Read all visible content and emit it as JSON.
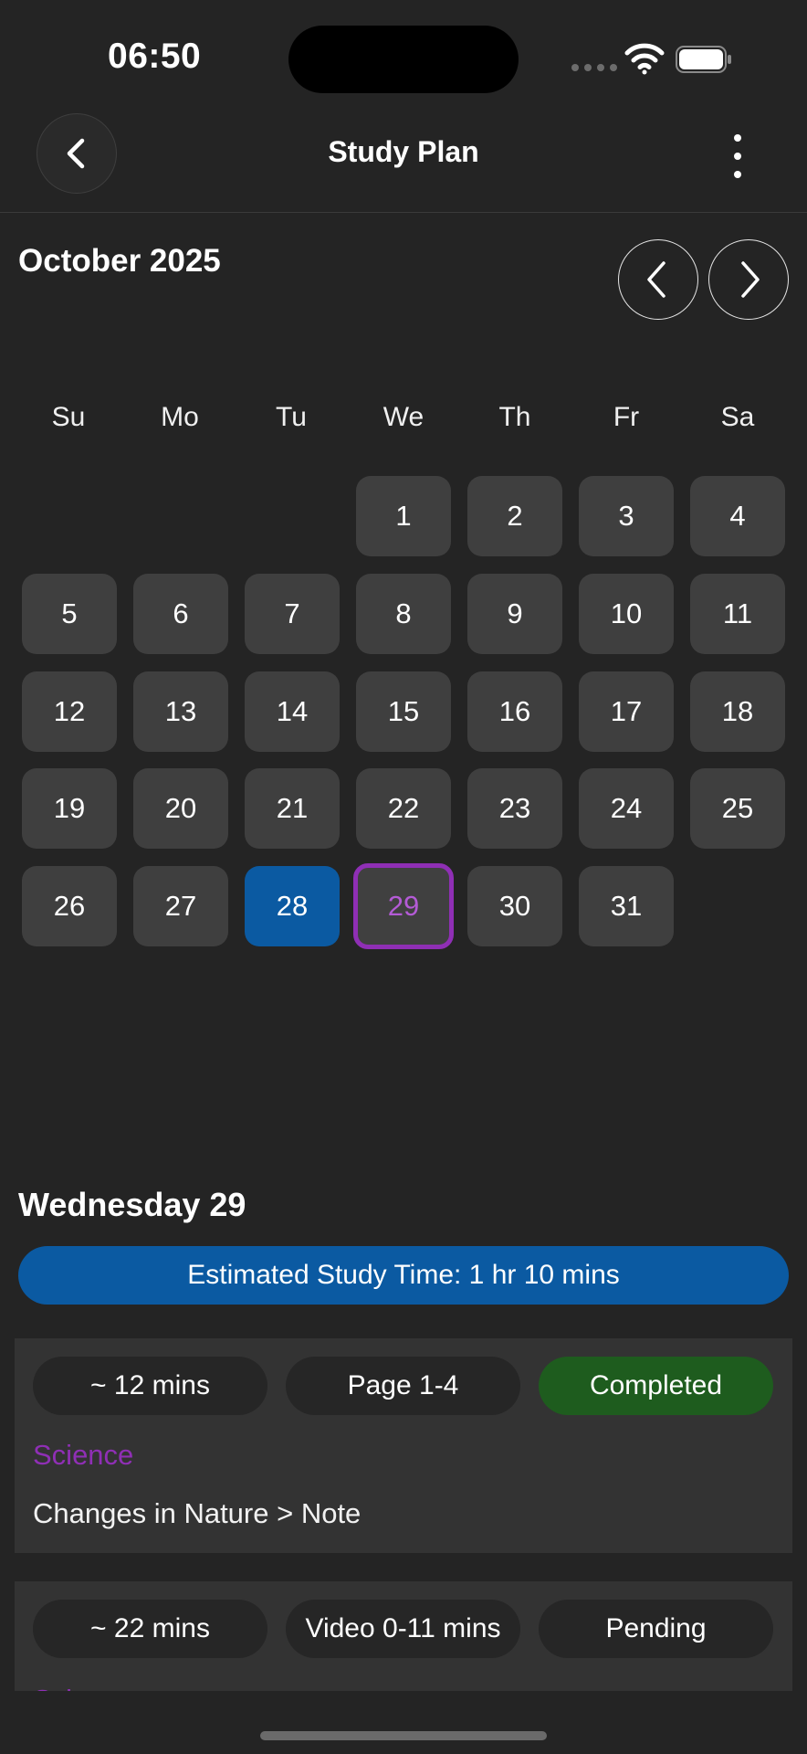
{
  "status_bar": {
    "time": "06:50"
  },
  "nav": {
    "title": "Study Plan"
  },
  "calendar": {
    "month_label": "October 2025",
    "weekdays": [
      "Su",
      "Mo",
      "Tu",
      "We",
      "Th",
      "Fr",
      "Sa"
    ],
    "days": [
      "1",
      "2",
      "3",
      "4",
      "5",
      "6",
      "7",
      "8",
      "9",
      "10",
      "11",
      "12",
      "13",
      "14",
      "15",
      "16",
      "17",
      "18",
      "19",
      "20",
      "21",
      "22",
      "23",
      "24",
      "25",
      "26",
      "27",
      "28",
      "29",
      "30",
      "31"
    ],
    "today": "28",
    "selected": "29",
    "colors": {
      "today": "#0b5aa2",
      "selected_border": "#8f2fb5",
      "cell": "#3f3f3f"
    }
  },
  "selected_day": {
    "title": "Wednesday 29",
    "estimated_time": "Estimated Study Time: 1 hr 10 mins"
  },
  "tasks": [
    {
      "duration": "~ 12 mins",
      "range": "Page 1-4",
      "status": "Completed",
      "subject": "Science",
      "topic": "Changes in Nature > Note"
    },
    {
      "duration": "~ 22 mins",
      "range": "Video 0-11 mins",
      "status": "Pending",
      "subject": "Science"
    }
  ],
  "icons": {
    "back": "chevron-left-icon",
    "more": "more-vertical-icon",
    "prev_month": "chevron-left-icon",
    "next_month": "chevron-right-icon",
    "wifi": "wifi-icon",
    "battery": "battery-icon"
  }
}
